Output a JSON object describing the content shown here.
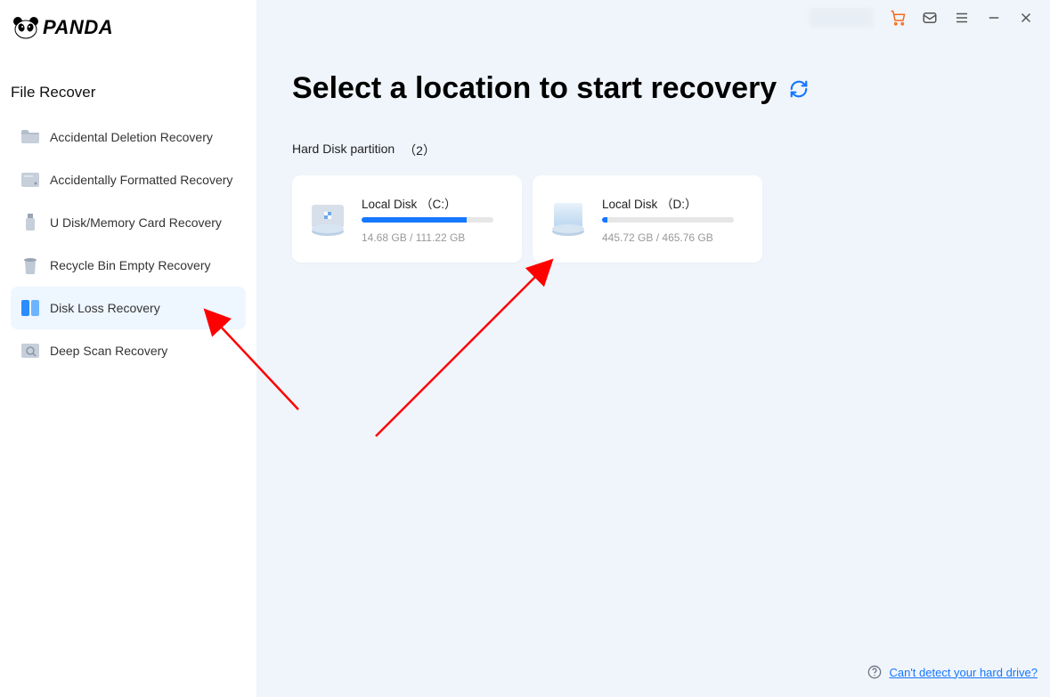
{
  "app_name": "PANDA",
  "sidebar": {
    "title": "File Recover",
    "items": [
      {
        "label": "Accidental Deletion Recovery",
        "icon": "folder-icon",
        "active": false
      },
      {
        "label": "Accidentally Formatted Recovery",
        "icon": "drive-icon",
        "active": false
      },
      {
        "label": "U Disk/Memory Card Recovery",
        "icon": "usb-icon",
        "active": false
      },
      {
        "label": "Recycle Bin Empty Recovery",
        "icon": "trash-icon",
        "active": false
      },
      {
        "label": "Disk Loss Recovery",
        "icon": "disk-stack-icon",
        "active": true
      },
      {
        "label": "Deep Scan Recovery",
        "icon": "scan-icon",
        "active": false
      }
    ]
  },
  "titlebar": {
    "icons": [
      "cart-icon",
      "mail-icon",
      "menu-icon",
      "minimize-icon",
      "close-icon"
    ]
  },
  "main": {
    "heading": "Select a location to start recovery",
    "section_label": "Hard Disk partition",
    "section_count": "（2）",
    "disks": [
      {
        "name": "Local Disk （C:）",
        "used": "14.68 GB",
        "total": "111.22 GB",
        "percent": 80,
        "kind": "system"
      },
      {
        "name": "Local Disk （D:）",
        "used": "445.72 GB",
        "total": "465.76 GB",
        "percent": 4,
        "kind": "data"
      }
    ]
  },
  "help": {
    "text": "Can't detect your hard drive?"
  },
  "colors": {
    "accent": "#1677ff",
    "bg_main": "#f0f5fb",
    "cart": "#f76b1c"
  }
}
